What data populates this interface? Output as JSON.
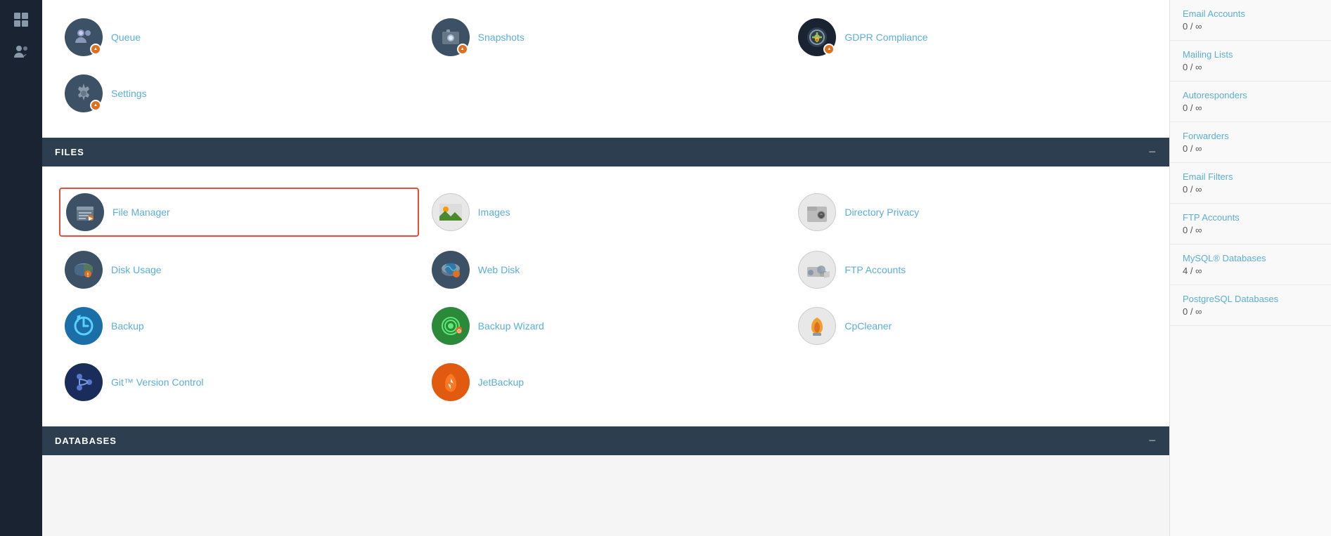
{
  "sidebar": {
    "icons": [
      {
        "name": "grid-icon",
        "label": "Apps"
      },
      {
        "name": "users-icon",
        "label": "Users"
      }
    ]
  },
  "top_section": {
    "items": [
      {
        "name": "Queue",
        "icon": "queue"
      },
      {
        "name": "Snapshots",
        "icon": "snapshots"
      },
      {
        "name": "GDPR Compliance",
        "icon": "gdpr"
      },
      {
        "name": "Settings",
        "icon": "settings"
      }
    ]
  },
  "files_section": {
    "header": "FILES",
    "collapse_label": "−",
    "items": [
      {
        "name": "File Manager",
        "icon": "file-manager",
        "highlighted": true
      },
      {
        "name": "Images",
        "icon": "images"
      },
      {
        "name": "Directory Privacy",
        "icon": "directory-privacy"
      },
      {
        "name": "Disk Usage",
        "icon": "disk-usage"
      },
      {
        "name": "Web Disk",
        "icon": "web-disk"
      },
      {
        "name": "FTP Accounts",
        "icon": "ftp-accounts"
      },
      {
        "name": "Backup",
        "icon": "backup"
      },
      {
        "name": "Backup Wizard",
        "icon": "backup-wizard"
      },
      {
        "name": "CpCleaner",
        "icon": "cpcleaner"
      },
      {
        "name": "Git™ Version Control",
        "icon": "git"
      },
      {
        "name": "JetBackup",
        "icon": "jetbackup"
      }
    ]
  },
  "databases_section": {
    "header": "DATABASES",
    "collapse_label": "−"
  },
  "right_sidebar": {
    "items": [
      {
        "label": "Email Accounts",
        "value": "0 / ∞"
      },
      {
        "label": "Mailing Lists",
        "value": "0 / ∞"
      },
      {
        "label": "Autoresponders",
        "value": "0 / ∞"
      },
      {
        "label": "Forwarders",
        "value": "0 / ∞"
      },
      {
        "label": "Email Filters",
        "value": "0 / ∞"
      },
      {
        "label": "FTP Accounts",
        "value": "0 / ∞"
      },
      {
        "label": "MySQL® Databases",
        "value": "4 / ∞"
      },
      {
        "label": "PostgreSQL Databases",
        "value": "0 / ∞"
      }
    ]
  }
}
